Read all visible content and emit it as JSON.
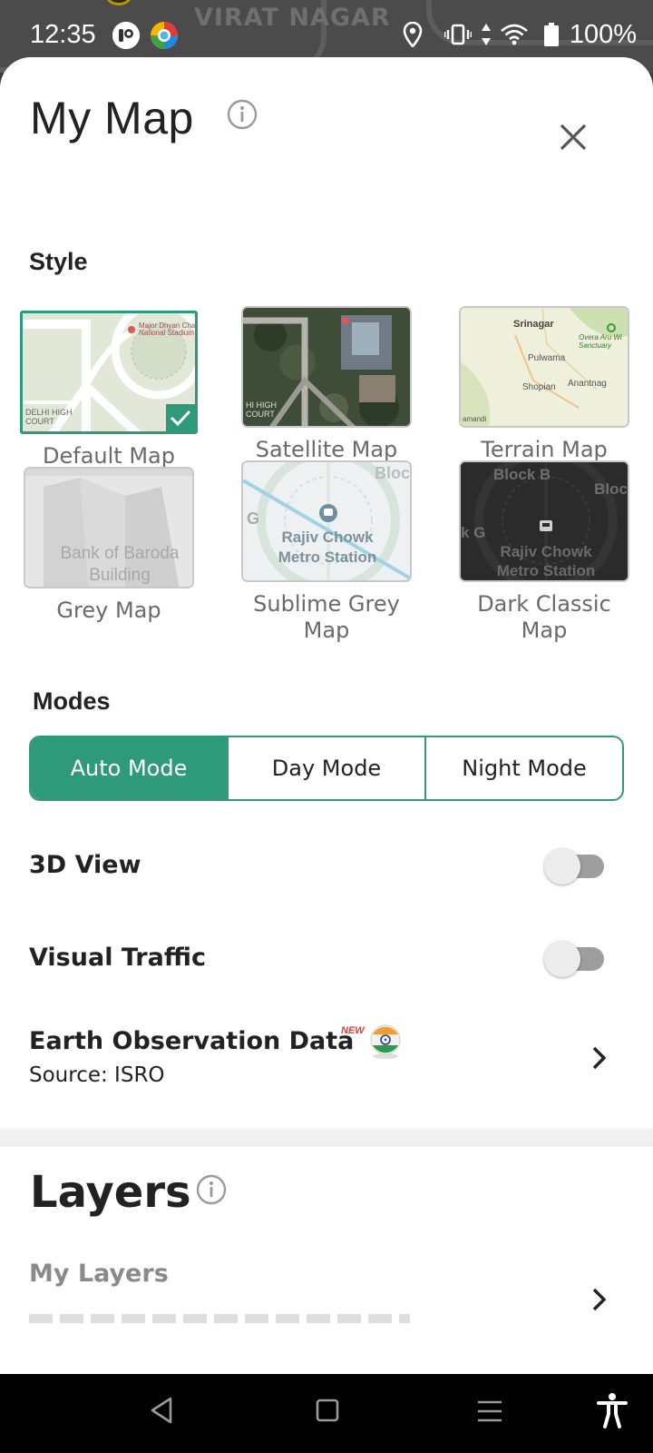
{
  "status_bar": {
    "time": "12:35",
    "battery_percent": "100%",
    "map_label": "VIRAT NAGAR",
    "icons": [
      "app-icon-1",
      "app-icon-2",
      "location-icon",
      "vibrate-icon",
      "data-arrows-icon",
      "wifi-icon",
      "battery-icon"
    ]
  },
  "sheet": {
    "title": "My Map",
    "style_section_label": "Style",
    "styles": [
      {
        "label": "Default Map",
        "selected": true
      },
      {
        "label": "Satellite Map",
        "selected": false
      },
      {
        "label": "Terrain Map",
        "selected": false
      },
      {
        "label": "Grey Map",
        "selected": false
      },
      {
        "label": "Sublime Grey Map",
        "selected": false
      },
      {
        "label": "Dark Classic Map",
        "selected": false
      }
    ],
    "thumb_text": {
      "default_poi": "Major Dhyan Cha National Stadium",
      "default_court": "DELHI HIGH COURT",
      "satellite_court": "HI HIGH COURT",
      "terrain_srinagar": "Srinagar",
      "terrain_pulwama": "Pulwama",
      "terrain_shopian": "Shopian",
      "terrain_anantnag": "Anantnag",
      "terrain_overa": "Overa Aru Wi Sanctuary",
      "terrain_amandi": "amandi",
      "grey_building": "Bank of Baroda Building",
      "sublime_block": "Bloc",
      "sublime_g": "G",
      "sublime_station": "Rajiv Chowk Metro Station",
      "dark_block_b": "Block B",
      "dark_block": "Bloc",
      "dark_g": "k G",
      "dark_station": "Rajiv Chowk Metro Station"
    },
    "modes_section_label": "Modes",
    "modes": [
      {
        "label": "Auto Mode",
        "active": true
      },
      {
        "label": "Day Mode",
        "active": false
      },
      {
        "label": "Night Mode",
        "active": false
      }
    ],
    "toggles": {
      "view_3d": {
        "label": "3D View",
        "on": false
      },
      "visual_traffic": {
        "label": "Visual Traffic",
        "on": false
      }
    },
    "earth_observation": {
      "title": "Earth Observation Data",
      "badge": "NEW",
      "subtitle": "Source: ISRO"
    },
    "layers": {
      "title": "Layers",
      "my_layers_label": "My Layers"
    }
  },
  "colors": {
    "accent": "#2e9a7a",
    "text_dark": "#222222",
    "text_grey": "#6a6a6a",
    "toggle_track_off": "#9e9e9e"
  },
  "nav_bar": {
    "icons": [
      "back-icon",
      "home-icon",
      "recents-icon",
      "accessibility-icon"
    ]
  }
}
